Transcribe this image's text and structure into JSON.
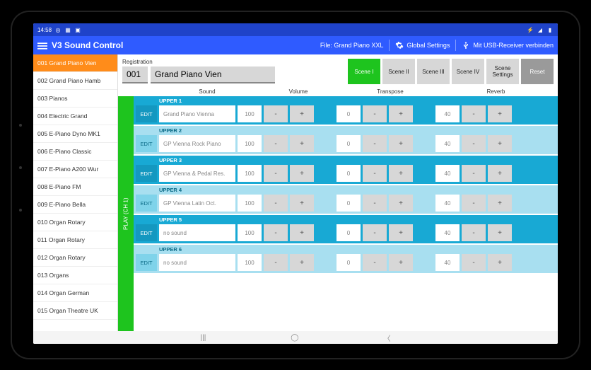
{
  "status": {
    "time": "14:58",
    "icons_left": [
      "◉",
      "▦",
      "▣"
    ],
    "icons_right": [
      "⚡",
      "◢",
      "▮"
    ]
  },
  "appbar": {
    "menu_icon": "menu-icon",
    "title": "V3 Sound Control",
    "file_label": "File: Grand Piano XXL",
    "settings_label": "Global Settings",
    "usb_label": "Mit USB-Receiver verbinden"
  },
  "sidebar": {
    "items": [
      "001 Grand Piano Vien",
      "002 Grand Piano Hamb",
      "003 Pianos",
      "004 Electric Grand",
      "005 E-Piano Dyno MK1",
      "006 E-Piano Classic",
      "007 E-Piano A200 Wur",
      "008 E-Piano FM",
      "009 E-Piano Bella",
      "010 Organ Rotary",
      "011 Organ Rotary",
      "012 Organ Rotary",
      "013 Organs",
      "014 Organ German",
      "015 Organ Theatre UK"
    ],
    "active_index": 0
  },
  "registration": {
    "label": "Registration",
    "number": "001",
    "name": "Grand Piano Vien"
  },
  "scenes": {
    "buttons": [
      "Scene I",
      "Scene II",
      "Scene III",
      "Scene IV"
    ],
    "settings": "Scene Settings",
    "reset": "Reset",
    "active_index": 0
  },
  "columns": {
    "sound": "Sound",
    "volume": "Volume",
    "transpose": "Transpose",
    "reverb": "Reverb"
  },
  "playbar": "PLAY (CH 1)",
  "edit_label": "EDIT",
  "minus": "-",
  "plus": "+",
  "tracks": [
    {
      "label": "UPPER 1",
      "sound": "Grand Piano Vienna",
      "volume": "100",
      "transpose": "0",
      "reverb": "40"
    },
    {
      "label": "UPPER 2",
      "sound": "GP Vienna Rock Piano",
      "volume": "100",
      "transpose": "0",
      "reverb": "40"
    },
    {
      "label": "UPPER 3",
      "sound": "GP Vienna & Pedal Res.",
      "volume": "100",
      "transpose": "0",
      "reverb": "40"
    },
    {
      "label": "UPPER 4",
      "sound": "GP Vienna Latin Oct.",
      "volume": "100",
      "transpose": "0",
      "reverb": "40"
    },
    {
      "label": "UPPER 5",
      "sound": "no sound",
      "volume": "100",
      "transpose": "0",
      "reverb": "40"
    },
    {
      "label": "UPPER 6",
      "sound": "no sound",
      "volume": "100",
      "transpose": "0",
      "reverb": "40"
    }
  ],
  "nav": {
    "recents": "|||",
    "home": "◯",
    "back": "〈"
  }
}
